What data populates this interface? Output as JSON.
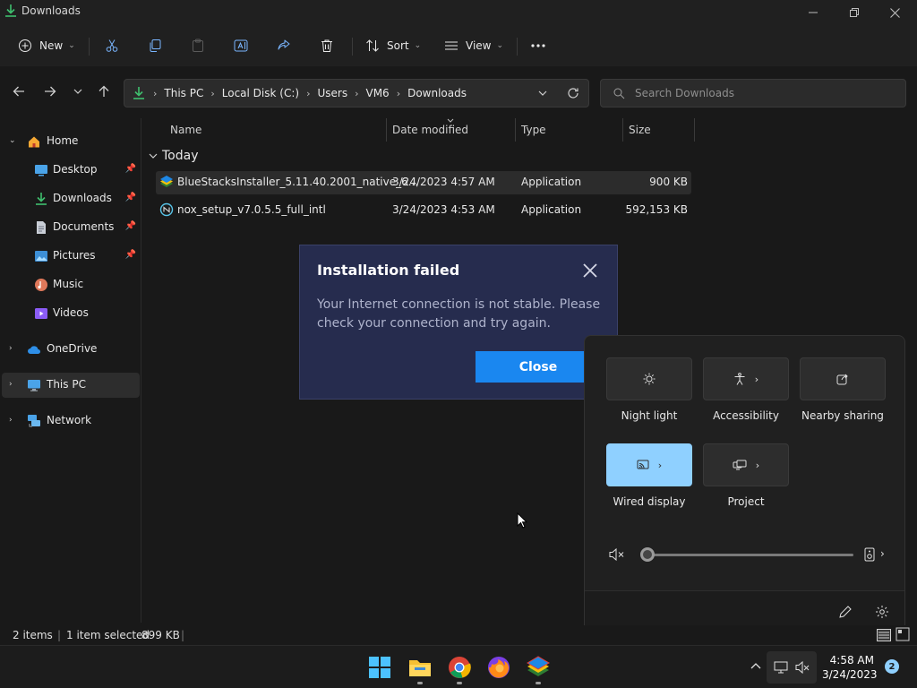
{
  "window": {
    "title": "Downloads",
    "minimize_icon": "minimize-icon",
    "maximize_icon": "restore-icon",
    "close_icon": "close-icon"
  },
  "toolbar": {
    "new_label": "New",
    "sort_label": "Sort",
    "view_label": "View",
    "icons": [
      "new-icon",
      "cut-icon",
      "copy-icon",
      "paste-icon",
      "rename-icon",
      "share-icon",
      "delete-icon",
      "sort-icon",
      "view-icon",
      "more-icon"
    ]
  },
  "address": {
    "crumbs": [
      "This PC",
      "Local Disk (C:)",
      "Users",
      "VM6",
      "Downloads"
    ],
    "search_placeholder": "Search Downloads"
  },
  "sidebar": {
    "items": [
      {
        "label": "Home",
        "icon": "home-icon"
      },
      {
        "label": "Desktop",
        "icon": "desktop-icon",
        "pinned": true
      },
      {
        "label": "Downloads",
        "icon": "downloads-icon",
        "pinned": true
      },
      {
        "label": "Documents",
        "icon": "documents-icon",
        "pinned": true
      },
      {
        "label": "Pictures",
        "icon": "pictures-icon",
        "pinned": true
      },
      {
        "label": "Music",
        "icon": "music-icon"
      },
      {
        "label": "Videos",
        "icon": "videos-icon"
      },
      {
        "label": "OneDrive",
        "icon": "onedrive-icon"
      },
      {
        "label": "This PC",
        "icon": "this-pc-icon"
      },
      {
        "label": "Network",
        "icon": "network-icon"
      }
    ]
  },
  "filelist": {
    "columns": [
      "Name",
      "Date modified",
      "Type",
      "Size"
    ],
    "group": "Today",
    "rows": [
      {
        "name": "BlueStacksInstaller_5.11.40.2001_native_6...",
        "date": "3/24/2023 4:57 AM",
        "type": "Application",
        "size": "900 KB",
        "selected": true
      },
      {
        "name": "nox_setup_v7.0.5.5_full_intl",
        "date": "3/24/2023 4:53 AM",
        "type": "Application",
        "size": "592,153 KB",
        "selected": false
      }
    ]
  },
  "dialog": {
    "title": "Installation failed",
    "message": "Your Internet connection is not stable. Please check your connection and try again.",
    "button": "Close"
  },
  "quick_settings": {
    "tiles": [
      {
        "label": "Night light",
        "icon": "night-light-icon",
        "active": false,
        "has_chevron": false
      },
      {
        "label": "Accessibility",
        "icon": "accessibility-icon",
        "active": false,
        "has_chevron": true
      },
      {
        "label": "Nearby sharing",
        "icon": "nearby-sharing-icon",
        "active": false,
        "has_chevron": false
      },
      {
        "label": "Wired display",
        "icon": "cast-icon",
        "active": true,
        "has_chevron": true
      },
      {
        "label": "Project",
        "icon": "project-icon",
        "active": false,
        "has_chevron": true
      }
    ],
    "volume_level": 0,
    "accent": "#8fd0ff"
  },
  "statusbar": {
    "items_count": "2 items",
    "selection": "1 item selected",
    "selection_size": "899 KB"
  },
  "taskbar": {
    "time": "4:58 AM",
    "date": "3/24/2023",
    "notification_count": "2"
  }
}
